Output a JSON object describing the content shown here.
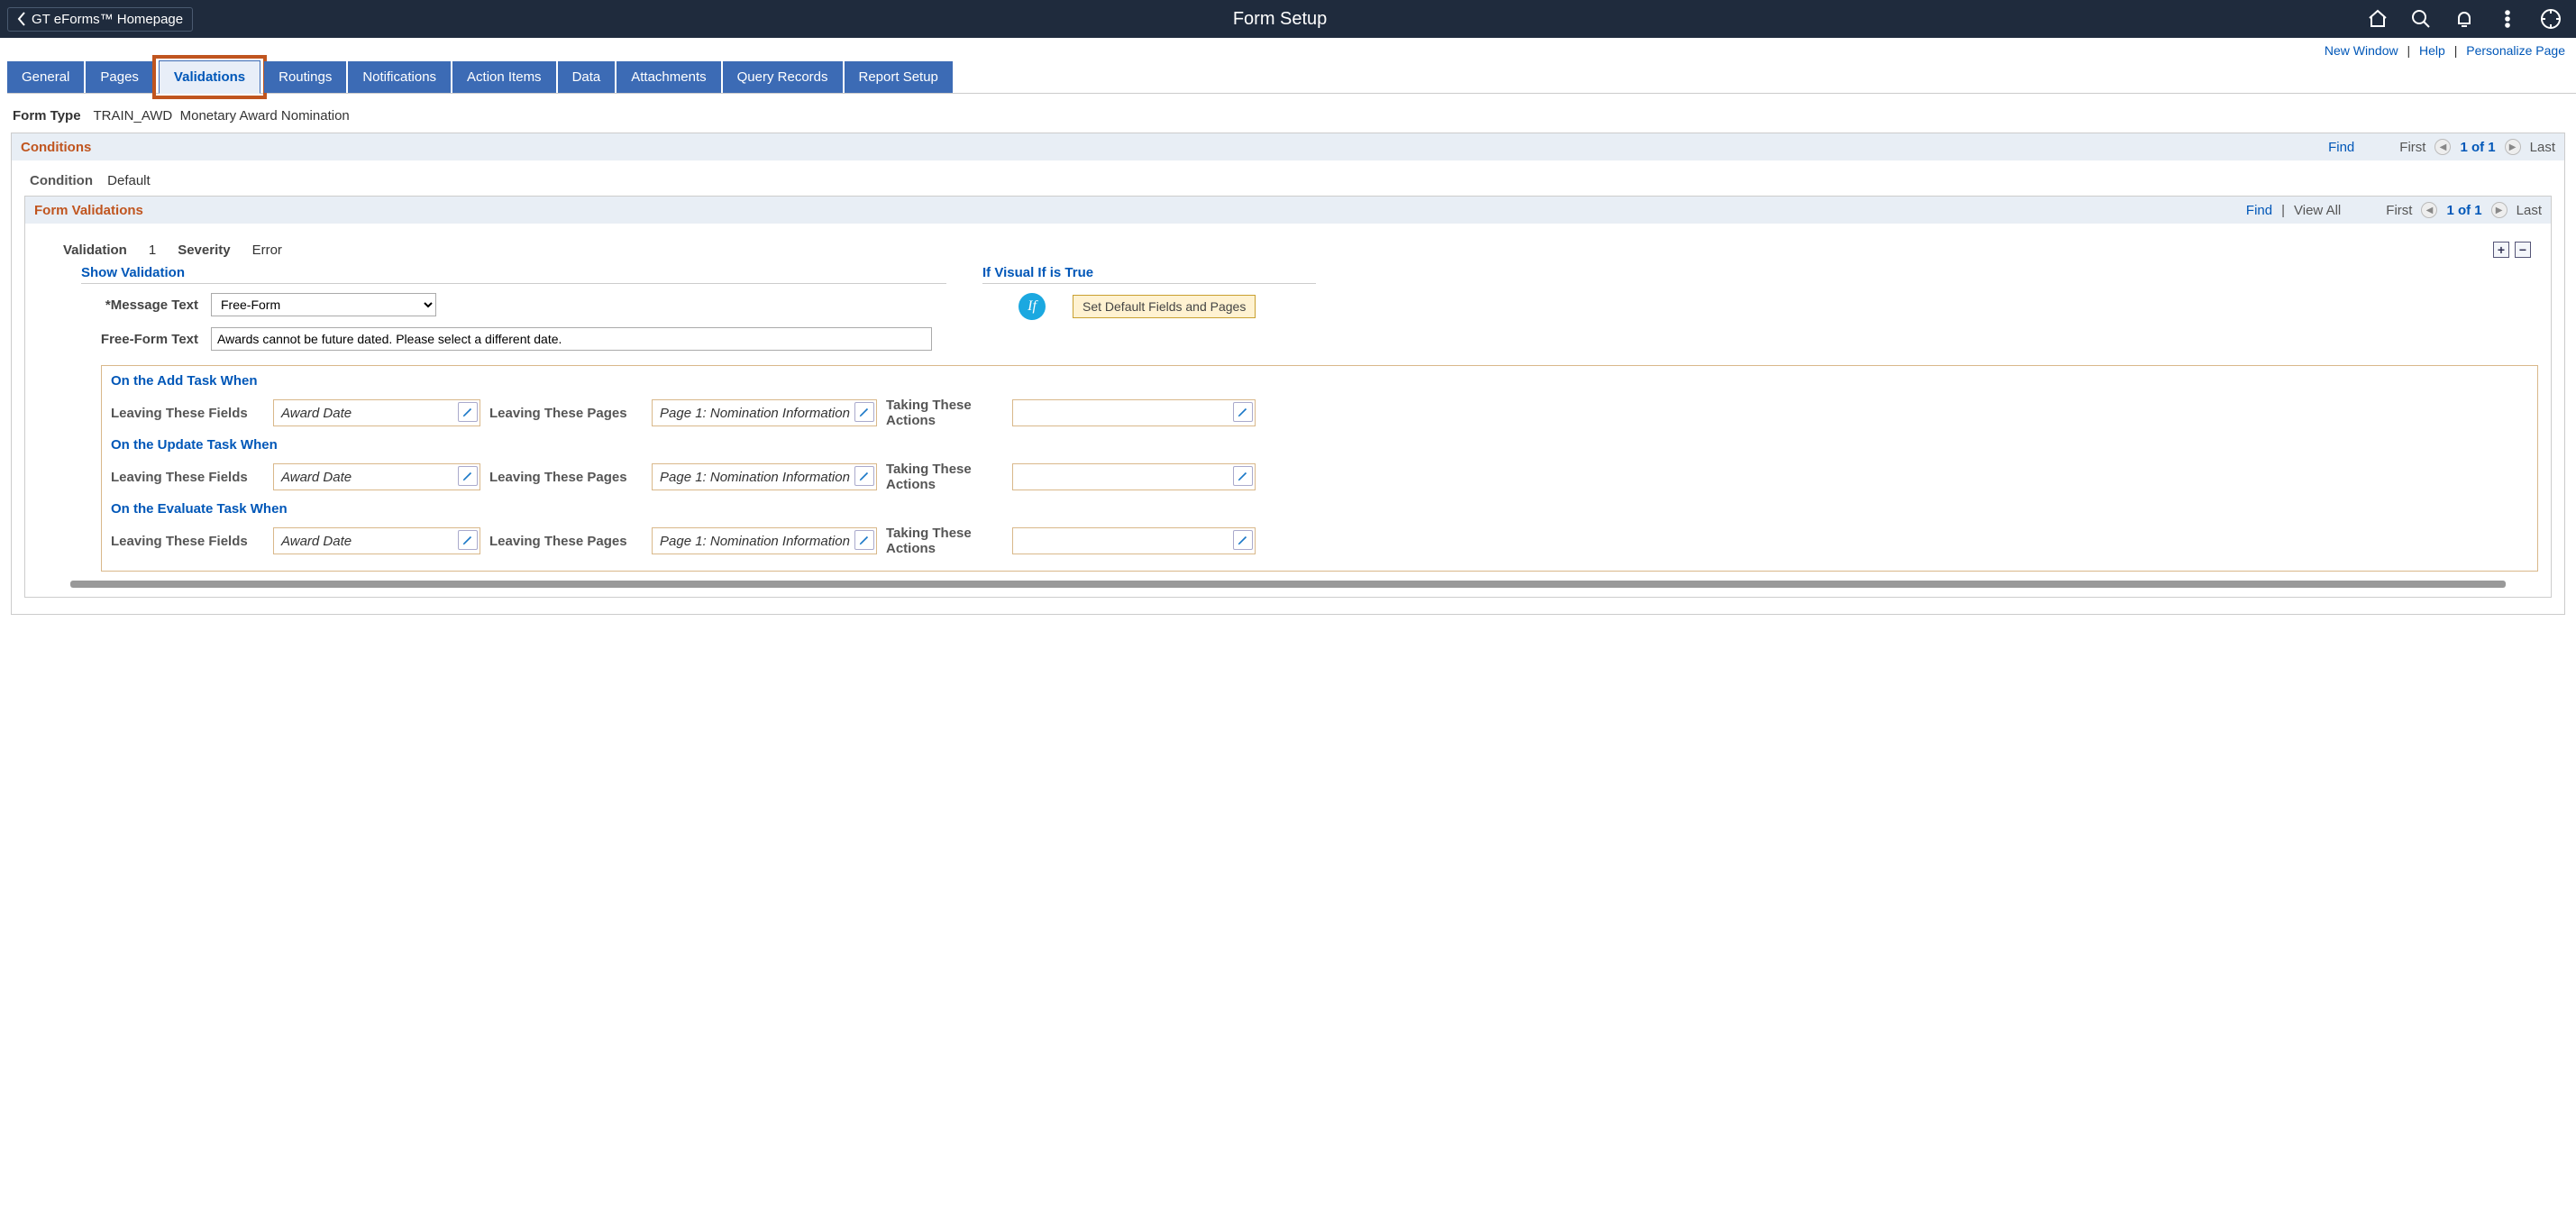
{
  "header": {
    "back_label": "GT eForms™ Homepage",
    "title": "Form Setup"
  },
  "toplinks": {
    "new_window": "New Window",
    "help": "Help",
    "personalize": "Personalize Page"
  },
  "tabs": {
    "general": "General",
    "pages": "Pages",
    "validations": "Validations",
    "routings": "Routings",
    "notifications": "Notifications",
    "action_items": "Action Items",
    "data": "Data",
    "attachments": "Attachments",
    "query_records": "Query Records",
    "report_setup": "Report Setup"
  },
  "form_type": {
    "label": "Form Type",
    "code": "TRAIN_AWD",
    "desc": "Monetary Award Nomination"
  },
  "conditions": {
    "title": "Conditions",
    "find": "Find",
    "first": "First",
    "nofn": "1 of 1",
    "last": "Last",
    "cond_label": "Condition",
    "cond_value": "Default"
  },
  "form_validations": {
    "title": "Form Validations",
    "find": "Find",
    "viewall": "View All",
    "first": "First",
    "nofn": "1 of 1",
    "last": "Last"
  },
  "validation": {
    "label": "Validation",
    "number": "1",
    "severity_label": "Severity",
    "severity_value": "Error",
    "show_validation": "Show Validation",
    "if_visual": "If Visual If is True",
    "msg_label": "*Message Text",
    "msg_value": "Free-Form",
    "ff_label": "Free-Form Text",
    "ff_value": "Awards cannot be future dated. Please select a different date.",
    "if_text": "If",
    "def_btn": "Set Default Fields and Pages"
  },
  "tasks": {
    "add_title": "On the Add Task When",
    "update_title": "On the Update Task When",
    "evaluate_title": "On the Evaluate Task When",
    "leaving_fields": "Leaving These Fields",
    "leaving_pages": "Leaving These Pages",
    "taking_actions": "Taking These Actions",
    "field_val": "Award Date",
    "page_val": "Page 1: Nomination Information",
    "action_val": ""
  }
}
